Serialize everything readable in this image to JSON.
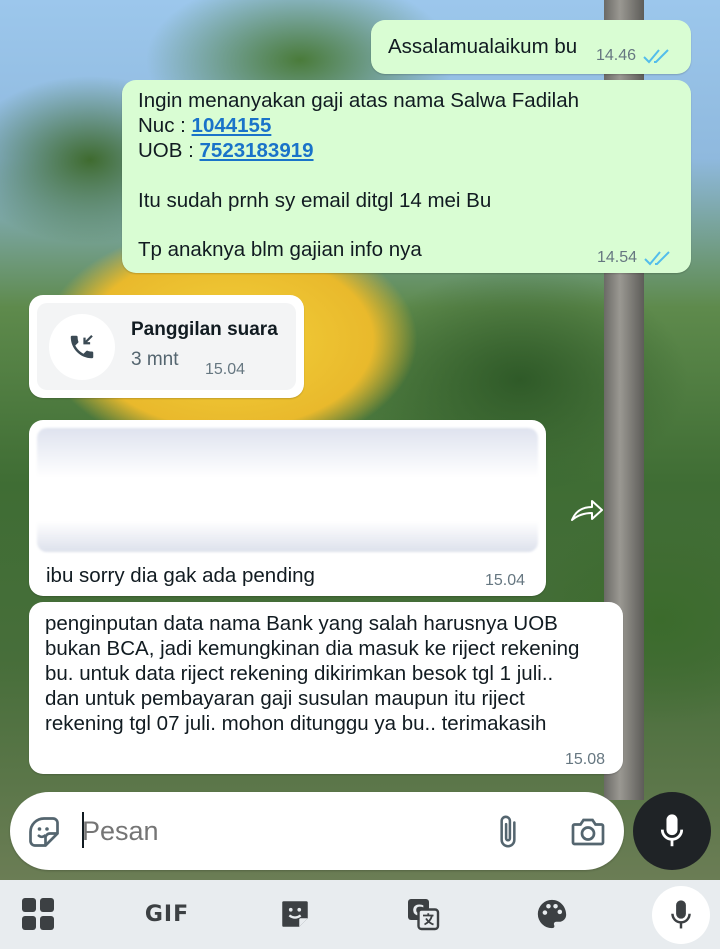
{
  "messages": {
    "m1": {
      "text": "Assalamualaikum bu",
      "time": "14.46"
    },
    "m2": {
      "line1": "Ingin menanyakan gaji atas nama Salwa Fadilah",
      "nuc_label": "Nuc : ",
      "nuc_value": "1044155",
      "uob_label": "UOB : ",
      "uob_value": "7523183919",
      "line4": "Itu sudah prnh sy email ditgl 14 mei Bu",
      "line5": "Tp anaknya blm gajian info nya",
      "time": "14.54"
    },
    "call": {
      "title": "Panggilan suara",
      "duration": "3 mnt",
      "time": "15.04"
    },
    "m4": {
      "text": "ibu sorry dia gak ada pending",
      "time": "15.04"
    },
    "m5": {
      "lines": [
        "penginputan data nama Bank yang salah harusnya UOB",
        "bukan BCA, jadi kemungkinan dia masuk ke riject rekening",
        "bu. untuk data riject rekening dikirimkan besok tgl 1 juli..",
        "dan untuk pembayaran gaji susulan maupun itu riject",
        "rekening tgl 07 juli. mohon ditunggu ya bu.. terimakasih"
      ],
      "time": "15.08"
    }
  },
  "composer": {
    "placeholder": "Pesan"
  },
  "keyboard": {
    "gif_label": "GIF"
  },
  "colors": {
    "outgoing": "#d9fdd3",
    "incoming": "#ffffff",
    "link": "#1a73c9",
    "read_ticks": "#53bdeb"
  },
  "icons": [
    "double-check-icon",
    "incoming-call-icon",
    "forward-icon",
    "sticker-icon",
    "attach-icon",
    "camera-icon",
    "mic-icon",
    "apps-grid-icon",
    "gif-icon",
    "sticker-pad-icon",
    "translate-icon",
    "palette-icon"
  ]
}
